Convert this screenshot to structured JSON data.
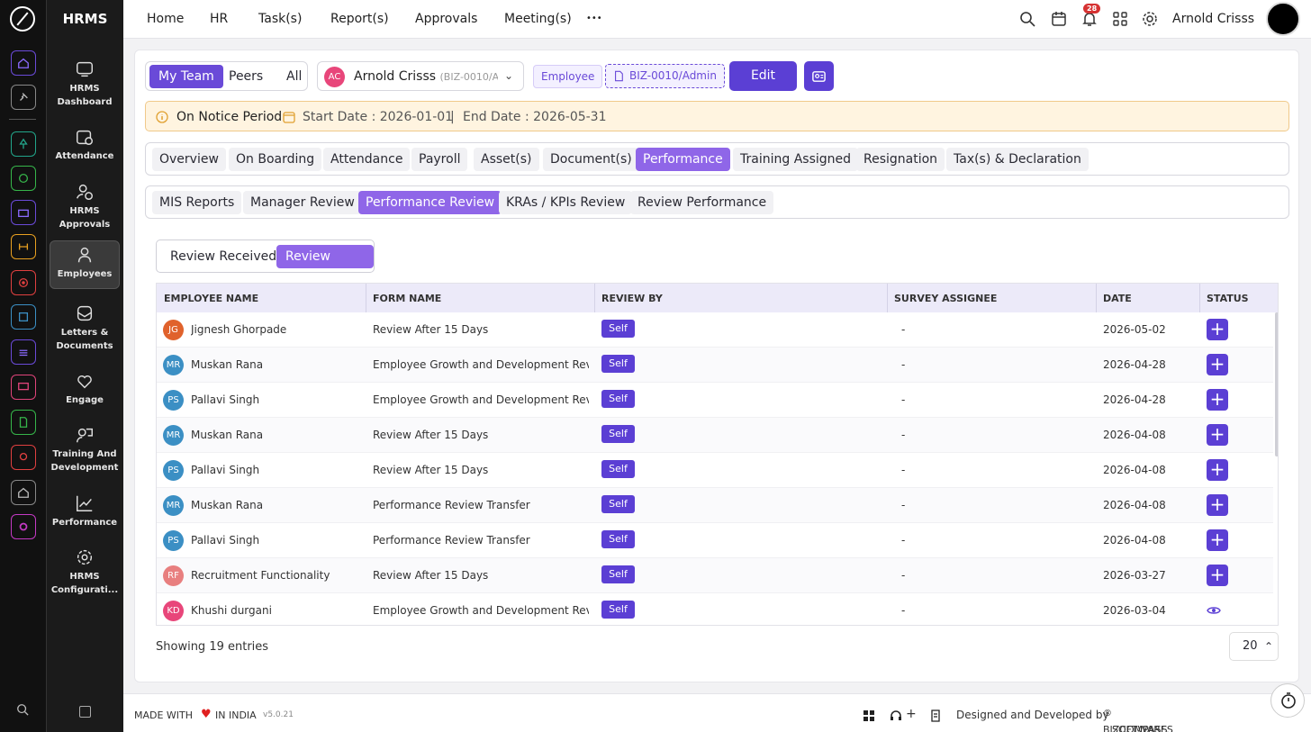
{
  "app": {
    "brand": "HRMS"
  },
  "rail": {
    "icons": [
      "home-icon",
      "pin-icon",
      "tree-icon",
      "dollar-icon",
      "briefcase-icon",
      "handshake-icon",
      "target-icon",
      "archive-icon",
      "stack-icon",
      "monitor-icon",
      "document-icon",
      "support-icon",
      "house-icon",
      "gear-icon"
    ]
  },
  "sidebar": {
    "items": [
      {
        "label": "HRMS Dashboard"
      },
      {
        "label": "Attendance"
      },
      {
        "label": "HRMS Approvals"
      },
      {
        "label": "Employees"
      },
      {
        "label": "Letters & Documents"
      },
      {
        "label": "Engage"
      },
      {
        "label": "Training And Development"
      },
      {
        "label": "Performance"
      },
      {
        "label": "HRMS Configurati..."
      }
    ]
  },
  "topnav": {
    "items": [
      "Home",
      "HR",
      "Task(s)",
      "Report(s)",
      "Approvals",
      "Meeting(s)"
    ],
    "more": "•••",
    "notification_count": "28",
    "user": "Arnold Crisss"
  },
  "filter": {
    "options": [
      "My Team",
      "Peers",
      "All"
    ],
    "selected": "My Team"
  },
  "employee": {
    "initials": "AC",
    "name": "Arnold Crisss",
    "code": "(BIZ-0010/Adr",
    "role": "Employee",
    "id": "BIZ-0010/Admin",
    "edit": "Edit"
  },
  "notice": {
    "status": "On Notice Period",
    "start": "Start Date : 2026-01-01",
    "sep": "|",
    "end": "End Date : 2026-05-31"
  },
  "main_tabs": [
    "Overview",
    "On Boarding",
    "Attendance",
    "Payroll",
    "Asset(s)",
    "Document(s)",
    "Performance",
    "Training Assigned",
    "Resignation",
    "Tax(s) & Declaration"
  ],
  "sub_tabs": [
    "MIS Reports",
    "Manager Review",
    "Performance Review",
    "KRAs / KPIs Review",
    "Review Performance"
  ],
  "review_switch": [
    "Review Received",
    "Review Given"
  ],
  "table": {
    "headers": [
      "EMPLOYEE NAME",
      "FORM NAME",
      "REVIEW BY",
      "SURVEY ASSIGNEE",
      "DATE",
      "STATUS"
    ],
    "rows": [
      {
        "initials": "JG",
        "color": "#e0622c",
        "name": "Jignesh Ghorpade",
        "form": "Review After 15 Days",
        "by": "Self",
        "assignee": "-",
        "date": "2026-05-02",
        "status": "add"
      },
      {
        "initials": "MR",
        "color": "#3b8fc4",
        "name": "Muskan Rana",
        "form": "Employee Growth and Development Revi...",
        "by": "Self",
        "assignee": "-",
        "date": "2026-04-28",
        "status": "add"
      },
      {
        "initials": "PS",
        "color": "#3b8fc4",
        "name": "Pallavi Singh",
        "form": "Employee Growth and Development Revi...",
        "by": "Self",
        "assignee": "-",
        "date": "2026-04-28",
        "status": "add"
      },
      {
        "initials": "MR",
        "color": "#3b8fc4",
        "name": "Muskan Rana",
        "form": "Review After 15 Days",
        "by": "Self",
        "assignee": "-",
        "date": "2026-04-08",
        "status": "add"
      },
      {
        "initials": "PS",
        "color": "#3b8fc4",
        "name": "Pallavi Singh",
        "form": "Review After 15 Days",
        "by": "Self",
        "assignee": "-",
        "date": "2026-04-08",
        "status": "add"
      },
      {
        "initials": "MR",
        "color": "#3b8fc4",
        "name": "Muskan Rana",
        "form": "Performance Review Transfer",
        "by": "Self",
        "assignee": "-",
        "date": "2026-04-08",
        "status": "add"
      },
      {
        "initials": "PS",
        "color": "#3b8fc4",
        "name": "Pallavi Singh",
        "form": "Performance Review Transfer",
        "by": "Self",
        "assignee": "-",
        "date": "2026-04-08",
        "status": "add"
      },
      {
        "initials": "RF",
        "color": "#e87f7f",
        "name": "Recruitment Functionality",
        "form": "Review After 15 Days",
        "by": "Self",
        "assignee": "-",
        "date": "2026-03-27",
        "status": "add"
      },
      {
        "initials": "KD",
        "color": "#e8467a",
        "name": "Khushi durgani",
        "form": "Employee Growth and Development Revi...",
        "by": "Self",
        "assignee": "-",
        "date": "2026-03-04",
        "status": "view"
      }
    ]
  },
  "showing": "Showing 19 entries",
  "page_size": "20",
  "footer": {
    "made": "MADE WITH",
    "india": "IN INDIA",
    "version": "v5.0.21",
    "designed": "Designed and Developed by",
    "company": "BIZCOMPASS",
    "reg": "®",
    "suffix": "SOFTWARES PVT"
  }
}
